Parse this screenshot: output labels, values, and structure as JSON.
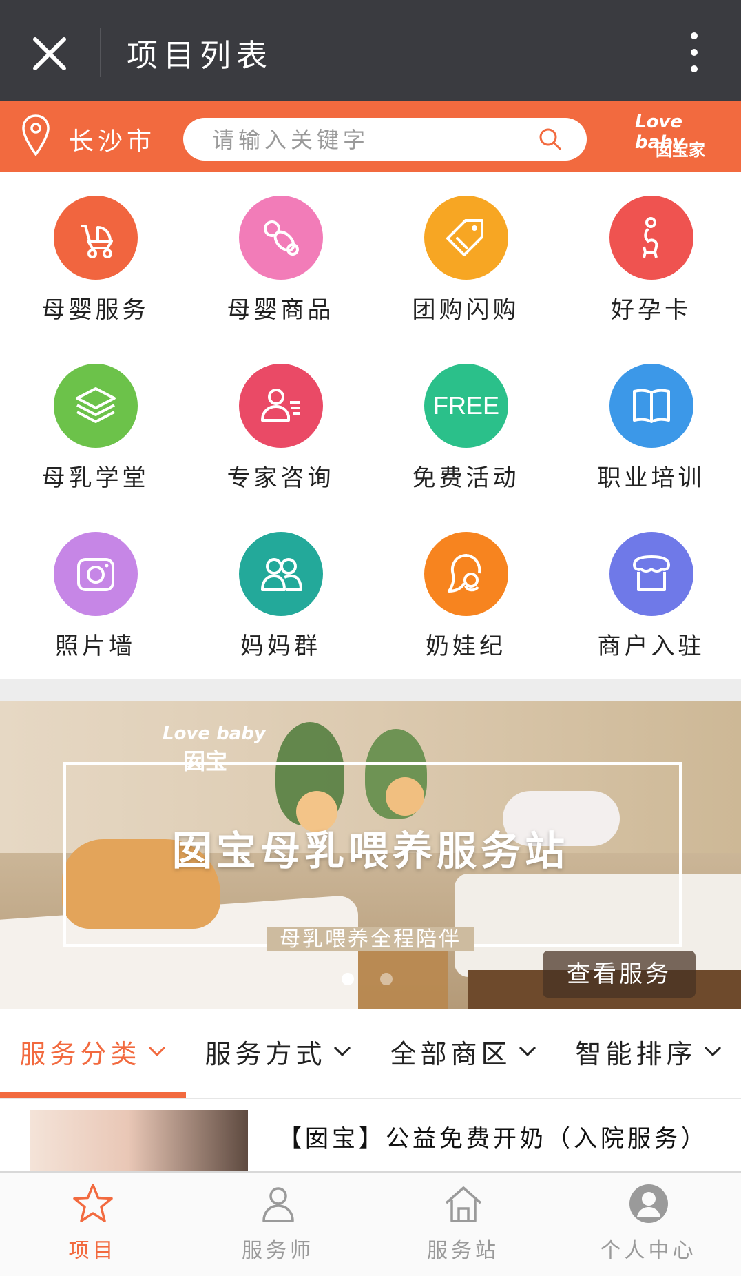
{
  "topbar": {
    "title": "项目列表"
  },
  "header": {
    "city": "长沙市",
    "search_placeholder": "请输入关键字",
    "logo_line1": "Love baby",
    "logo_line2": "囡宝家"
  },
  "grid": {
    "items": [
      {
        "label": "母婴服务",
        "icon": "stroller-icon",
        "color": "#f1653f"
      },
      {
        "label": "母婴商品",
        "icon": "pacifier-icon",
        "color": "#f27cb8"
      },
      {
        "label": "团购闪购",
        "icon": "price-tag-icon",
        "color": "#f7a623"
      },
      {
        "label": "好孕卡",
        "icon": "pregnant-woman-icon",
        "color": "#ef5350"
      },
      {
        "label": "母乳学堂",
        "icon": "layers-icon",
        "color": "#6cc24a"
      },
      {
        "label": "专家咨询",
        "icon": "expert-profile-icon",
        "color": "#ea4a66"
      },
      {
        "label": "免费活动",
        "icon": "free-badge-icon",
        "color": "#2bc08a"
      },
      {
        "label": "职业培训",
        "icon": "open-book-icon",
        "color": "#3c98e8"
      },
      {
        "label": "照片墙",
        "icon": "camera-icon",
        "color": "#c686e6"
      },
      {
        "label": "妈妈群",
        "icon": "group-icon",
        "color": "#23a99a"
      },
      {
        "label": "奶娃纪",
        "icon": "mother-baby-icon",
        "color": "#f7841f"
      },
      {
        "label": "商户入驻",
        "icon": "storefront-icon",
        "color": "#6f79e8"
      }
    ],
    "free_text": "FREE"
  },
  "banner": {
    "logo_line1": "Love baby",
    "logo_line2": "囡宝",
    "headline": "囡宝母乳喂养服务站",
    "subline": "母乳喂养全程陪伴",
    "button": "查看服务",
    "slide_count": 2,
    "active_slide": 1
  },
  "filters": {
    "tabs": [
      {
        "label": "服务分类",
        "active": true
      },
      {
        "label": "服务方式",
        "active": false
      },
      {
        "label": "全部商区",
        "active": false
      },
      {
        "label": "智能排序",
        "active": false
      }
    ]
  },
  "list": {
    "items": [
      {
        "title": "【囡宝】公益免费开奶（入院服务）"
      }
    ]
  },
  "bottom_nav": {
    "items": [
      {
        "label": "项目",
        "icon": "star-icon",
        "active": true
      },
      {
        "label": "服务师",
        "icon": "person-icon",
        "active": false
      },
      {
        "label": "服务站",
        "icon": "home-icon",
        "active": false
      },
      {
        "label": "个人中心",
        "icon": "user-avatar-icon",
        "active": false
      }
    ]
  },
  "colors": {
    "accent": "#f26a3f",
    "topbar": "#3a3b40",
    "inactive_nav": "#9a9a9a"
  }
}
